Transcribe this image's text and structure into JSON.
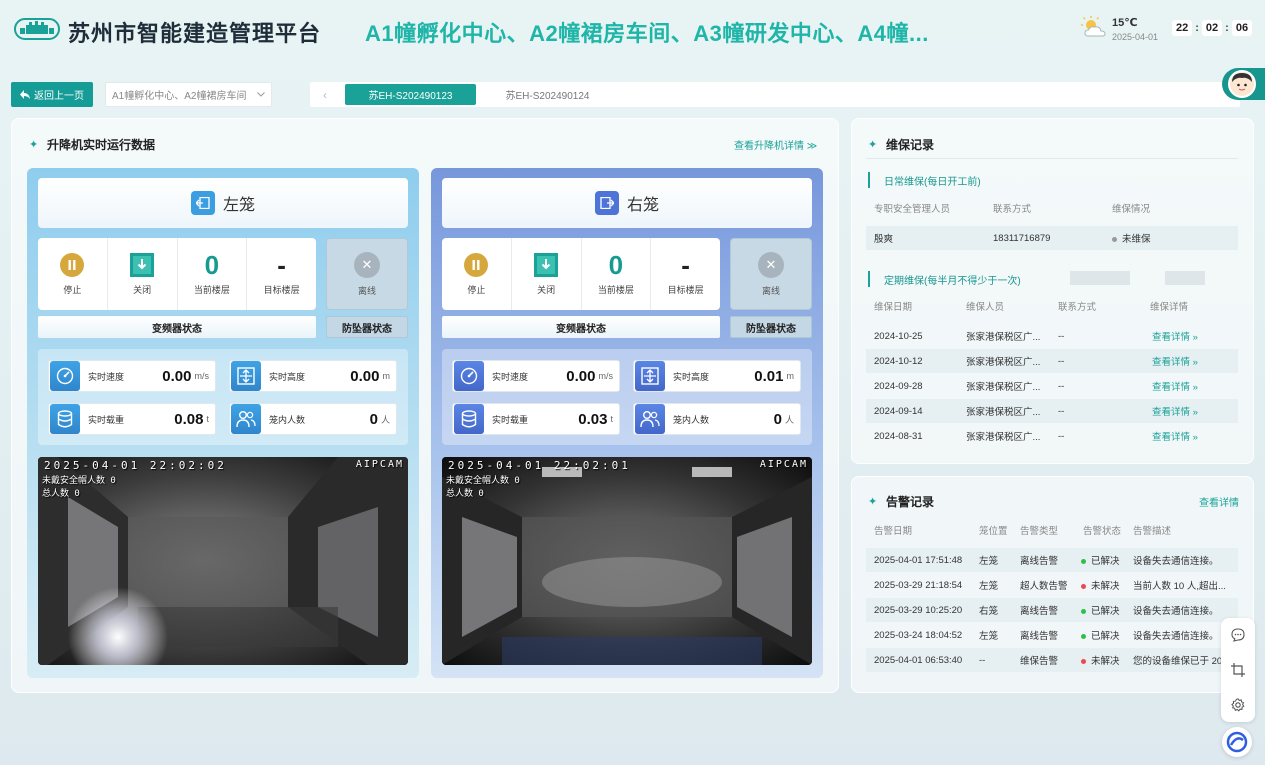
{
  "header": {
    "platform_title": "苏州市智能建造管理平台",
    "banner": "A1幢孵化中心、A2幢裙房车间、A3幢研发中心、A4幢...",
    "weather": {
      "temp": "15℃",
      "date": "2025-04-01",
      "icon": "partly-cloudy-icon"
    },
    "clock": {
      "h": "22",
      "m": "02",
      "s": "06",
      "sep": ":"
    }
  },
  "toolbar": {
    "back_label": "返回上一页",
    "project_select": "A1幢孵化中心、A2幢裙房车间",
    "tab_prev": "‹",
    "tabs": [
      {
        "label": "苏EH-S202490123",
        "active": true
      },
      {
        "label": "苏EH-S202490124",
        "active": false
      }
    ]
  },
  "elevator": {
    "title": "升降机实时运行数据",
    "detail_link": "查看升降机详情 ≫",
    "cages": [
      {
        "name": "左笼",
        "statuses": [
          {
            "label": "停止",
            "icon": "pause-icon"
          },
          {
            "label": "关闭",
            "icon": "door-closed-icon"
          },
          {
            "label": "当前楼层",
            "value": "0"
          },
          {
            "label": "目标楼层",
            "value": "-"
          }
        ],
        "offline_label": "离线",
        "inverter_label": "变频器状态",
        "fall_label": "防坠器状态",
        "metrics": [
          {
            "label": "实时速度",
            "value": "0.00",
            "unit": "m/s",
            "icon": "speedometer-icon"
          },
          {
            "label": "实时高度",
            "value": "0.00",
            "unit": "m",
            "icon": "height-icon"
          },
          {
            "label": "实时载重",
            "value": "0.08",
            "unit": "t",
            "icon": "database-icon"
          },
          {
            "label": "笼内人数",
            "value": "0",
            "unit": "人",
            "icon": "people-icon"
          }
        ],
        "camera": {
          "timestamp": "2025-04-01 22:02:02",
          "brand": "AIPCAM",
          "line1": "未戴安全帽人数 0",
          "line2": "总人数 0"
        }
      },
      {
        "name": "右笼",
        "statuses": [
          {
            "label": "停止",
            "icon": "pause-icon"
          },
          {
            "label": "关闭",
            "icon": "door-closed-icon"
          },
          {
            "label": "当前楼层",
            "value": "0"
          },
          {
            "label": "目标楼层",
            "value": "-"
          }
        ],
        "offline_label": "离线",
        "inverter_label": "变频器状态",
        "fall_label": "防坠器状态",
        "metrics": [
          {
            "label": "实时速度",
            "value": "0.00",
            "unit": "m/s",
            "icon": "speedometer-icon"
          },
          {
            "label": "实时高度",
            "value": "0.01",
            "unit": "m",
            "icon": "height-icon"
          },
          {
            "label": "实时载重",
            "value": "0.03",
            "unit": "t",
            "icon": "database-icon"
          },
          {
            "label": "笼内人数",
            "value": "0",
            "unit": "人",
            "icon": "people-icon"
          }
        ],
        "camera": {
          "timestamp": "2025-04-01 22:02:01",
          "brand": "AIPCAM",
          "line1": "未戴安全帽人数 0",
          "line2": "总人数 0"
        }
      }
    ]
  },
  "maintenance": {
    "title": "维保记录",
    "daily": {
      "title": "日常维保(每日开工前)",
      "headers": [
        "专职安全管理人员",
        "联系方式",
        "维保情况"
      ],
      "row": {
        "name": "殷爽",
        "phone": "18311716879",
        "status": "未维保",
        "status_color": "#999999"
      }
    },
    "periodic": {
      "title": "定期维保(每半月不得少于一次)",
      "headers": [
        "维保日期",
        "维保人员",
        "联系方式",
        "维保详情"
      ],
      "rows": [
        {
          "date": "2024-10-25",
          "person": "张家港保税区广...",
          "phone": "--",
          "link": "查看详情 »"
        },
        {
          "date": "2024-10-12",
          "person": "张家港保税区广...",
          "phone": "--",
          "link": "查看详情 »"
        },
        {
          "date": "2024-09-28",
          "person": "张家港保税区广...",
          "phone": "--",
          "link": "查看详情 »"
        },
        {
          "date": "2024-09-14",
          "person": "张家港保税区广...",
          "phone": "--",
          "link": "查看详情 »"
        },
        {
          "date": "2024-08-31",
          "person": "张家港保税区广...",
          "phone": "--",
          "link": "查看详情 »"
        }
      ]
    }
  },
  "alarms": {
    "title": "告警记录",
    "detail_link": "查看详情",
    "headers": [
      "告警日期",
      "笼位置",
      "告警类型",
      "告警状态",
      "告警描述"
    ],
    "rows": [
      {
        "date": "2025-04-01 17:51:48",
        "cage": "左笼",
        "type": "离线告警",
        "status": "已解决",
        "color": "#2fbf4a",
        "desc": "设备失去通信连接。"
      },
      {
        "date": "2025-03-29 21:18:54",
        "cage": "左笼",
        "type": "超人数告警",
        "status": "未解决",
        "color": "#f0494d",
        "desc": "当前人数 10 人,超出..."
      },
      {
        "date": "2025-03-29 10:25:20",
        "cage": "右笼",
        "type": "离线告警",
        "status": "已解决",
        "color": "#2fbf4a",
        "desc": "设备失去通信连接。"
      },
      {
        "date": "2025-03-24 18:04:52",
        "cage": "左笼",
        "type": "离线告警",
        "status": "已解决",
        "color": "#2fbf4a",
        "desc": "设备失去通信连接。"
      },
      {
        "date": "2025-04-01 06:53:40",
        "cage": "--",
        "type": "维保告警",
        "status": "未解决",
        "color": "#f0494d",
        "desc": "您的设备维保已于 20"
      }
    ]
  },
  "side_tools": [
    "chat-icon",
    "crop-icon",
    "settings-icon"
  ],
  "colors": {
    "accent": "#1aa198",
    "left_cage": "#3a9ee0",
    "right_cage": "#4d74d6"
  }
}
